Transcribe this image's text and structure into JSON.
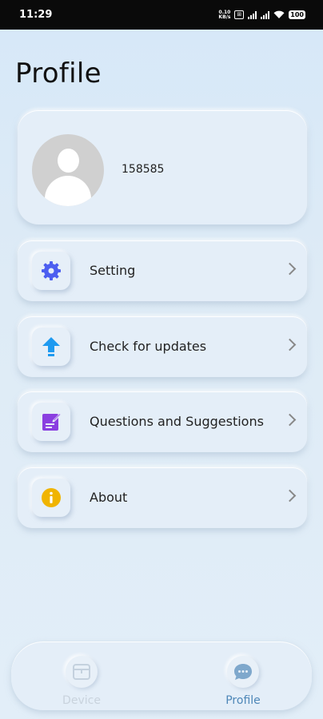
{
  "status_bar": {
    "time": "11:29",
    "speed_value": "0.10",
    "speed_unit": "KB/s",
    "box_badge": "⊞",
    "battery": "100"
  },
  "page_title": "Profile",
  "profile": {
    "username": "158585"
  },
  "menu": {
    "items": [
      {
        "label": "Setting",
        "icon": "gear-icon",
        "color": "#4c5ef0"
      },
      {
        "label": "Check for updates",
        "icon": "upload-arrow-icon",
        "color": "#1e9af0"
      },
      {
        "label": "Questions and Suggestions",
        "icon": "edit-note-icon",
        "color": "#8a3fe0"
      },
      {
        "label": "About",
        "icon": "info-icon",
        "color": "#f0b400"
      }
    ]
  },
  "bottom_nav": {
    "device_label": "Device",
    "profile_label": "Profile",
    "active": "Profile"
  }
}
